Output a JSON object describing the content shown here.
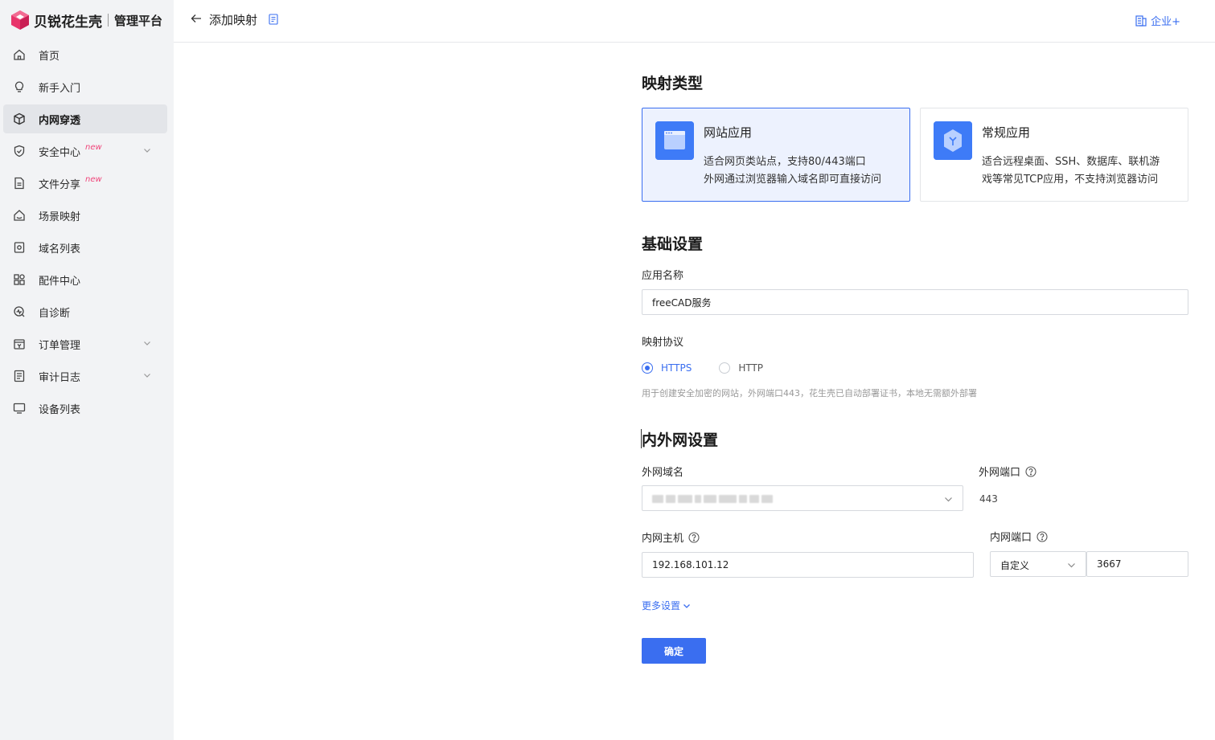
{
  "brand": {
    "name": "贝锐花生壳",
    "subtitle": "管理平台",
    "accent": "#e8356b"
  },
  "sidebar": {
    "items": [
      {
        "label": "首页",
        "icon": "home-icon"
      },
      {
        "label": "新手入门",
        "icon": "lightbulb-icon"
      },
      {
        "label": "内网穿透",
        "icon": "cube-icon",
        "active": true
      },
      {
        "label": "安全中心",
        "icon": "shield-check-icon",
        "badge": "new",
        "expandable": true
      },
      {
        "label": "文件分享",
        "icon": "file-share-icon",
        "badge": "new"
      },
      {
        "label": "场景映射",
        "icon": "house-scene-icon"
      },
      {
        "label": "域名列表",
        "icon": "domain-icon"
      },
      {
        "label": "配件中心",
        "icon": "grid-icon"
      },
      {
        "label": "自诊断",
        "icon": "diagnose-icon"
      },
      {
        "label": "订单管理",
        "icon": "order-icon",
        "expandable": true
      },
      {
        "label": "审计日志",
        "icon": "log-icon",
        "expandable": true
      },
      {
        "label": "设备列表",
        "icon": "device-icon"
      }
    ]
  },
  "header": {
    "title": "添加映射",
    "enterprise_label": "企业+"
  },
  "mapping_type": {
    "section_title": "映射类型",
    "cards": [
      {
        "title": "网站应用",
        "desc_line1": "适合网页类站点，支持80/443端口",
        "desc_line2": "外网通过浏览器输入域名即可直接访问",
        "selected": true
      },
      {
        "title": "常规应用",
        "desc_line1": "适合远程桌面、SSH、数据库、联机游",
        "desc_line2": "戏等常见TCP应用，不支持浏览器访问",
        "selected": false
      }
    ]
  },
  "basic": {
    "section_title": "基础设置",
    "app_name_label": "应用名称",
    "app_name_value": "freeCAD服务",
    "protocol_label": "映射协议",
    "protocols": [
      {
        "label": "HTTPS",
        "checked": true
      },
      {
        "label": "HTTP",
        "checked": false
      }
    ],
    "protocol_hint": "用于创建安全加密的网站，外网端口443，花生壳已自动部署证书，本地无需额外部署"
  },
  "network": {
    "section_title": "内外网设置",
    "external_domain_label": "外网域名",
    "external_port_label": "外网端口",
    "external_port_value": "443",
    "internal_host_label": "内网主机",
    "internal_host_value": "192.168.101.12",
    "internal_port_label": "内网端口",
    "internal_port_mode": "自定义",
    "internal_port_value": "3667",
    "more_settings": "更多设置"
  },
  "actions": {
    "confirm": "确定"
  },
  "colors": {
    "primary": "#3a6ef0",
    "card_icon": "#3e7bf7",
    "new_badge": "#f0457a"
  }
}
